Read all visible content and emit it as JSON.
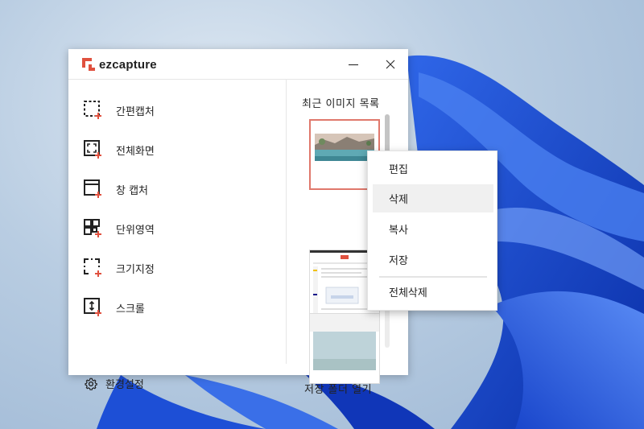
{
  "app": {
    "brand": "ezcapture",
    "brand_color": "#e0513f"
  },
  "menu": {
    "items": [
      {
        "label": "간편캡처",
        "icon": "region-capture-icon"
      },
      {
        "label": "전체화면",
        "icon": "fullscreen-capture-icon"
      },
      {
        "label": "창 캡처",
        "icon": "window-capture-icon"
      },
      {
        "label": "단위영역",
        "icon": "unit-area-capture-icon"
      },
      {
        "label": "크기지정",
        "icon": "fixed-size-capture-icon"
      },
      {
        "label": "스크롤",
        "icon": "scroll-capture-icon"
      }
    ],
    "settings_label": "환경설정"
  },
  "recent": {
    "title": "최근 이미지 목록",
    "open_folder_label": "저장 폴더 열기"
  },
  "context_menu": {
    "items": [
      "편집",
      "삭제",
      "복사",
      "저장"
    ],
    "delete_all": "전체삭제"
  }
}
